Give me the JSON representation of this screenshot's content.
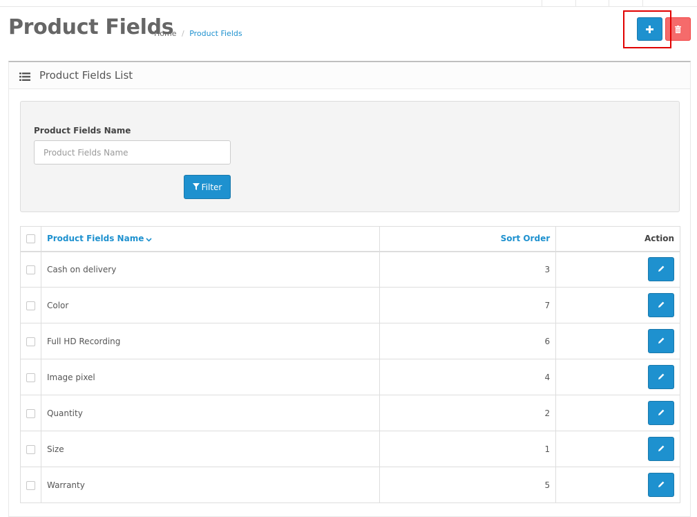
{
  "header": {
    "title": "Product Fields",
    "breadcrumb": [
      {
        "label": "Home"
      },
      {
        "label": "Product Fields"
      }
    ],
    "breadcrumb_sep": "/",
    "add_button_icon": "plus-icon",
    "delete_button_icon": "trash-icon"
  },
  "panel": {
    "title": "Product Fields List",
    "icon": "list-icon"
  },
  "filter": {
    "label": "Product Fields Name",
    "placeholder": "Product Fields Name",
    "value": "",
    "button_label": "Filter",
    "button_icon": "filter-icon"
  },
  "table": {
    "columns": {
      "name": "Product Fields Name",
      "sort": "Sort Order",
      "action": "Action"
    },
    "rows": [
      {
        "name": "Cash on delivery",
        "sort_order": "3"
      },
      {
        "name": "Color",
        "sort_order": "7"
      },
      {
        "name": "Full HD Recording",
        "sort_order": "6"
      },
      {
        "name": "Image pixel",
        "sort_order": "4"
      },
      {
        "name": "Quantity",
        "sort_order": "2"
      },
      {
        "name": "Size",
        "sort_order": "1"
      },
      {
        "name": "Warranty",
        "sort_order": "5"
      }
    ]
  },
  "colors": {
    "primary": "#1e91cf",
    "danger": "#f56b6b",
    "highlight": "#e00000"
  }
}
